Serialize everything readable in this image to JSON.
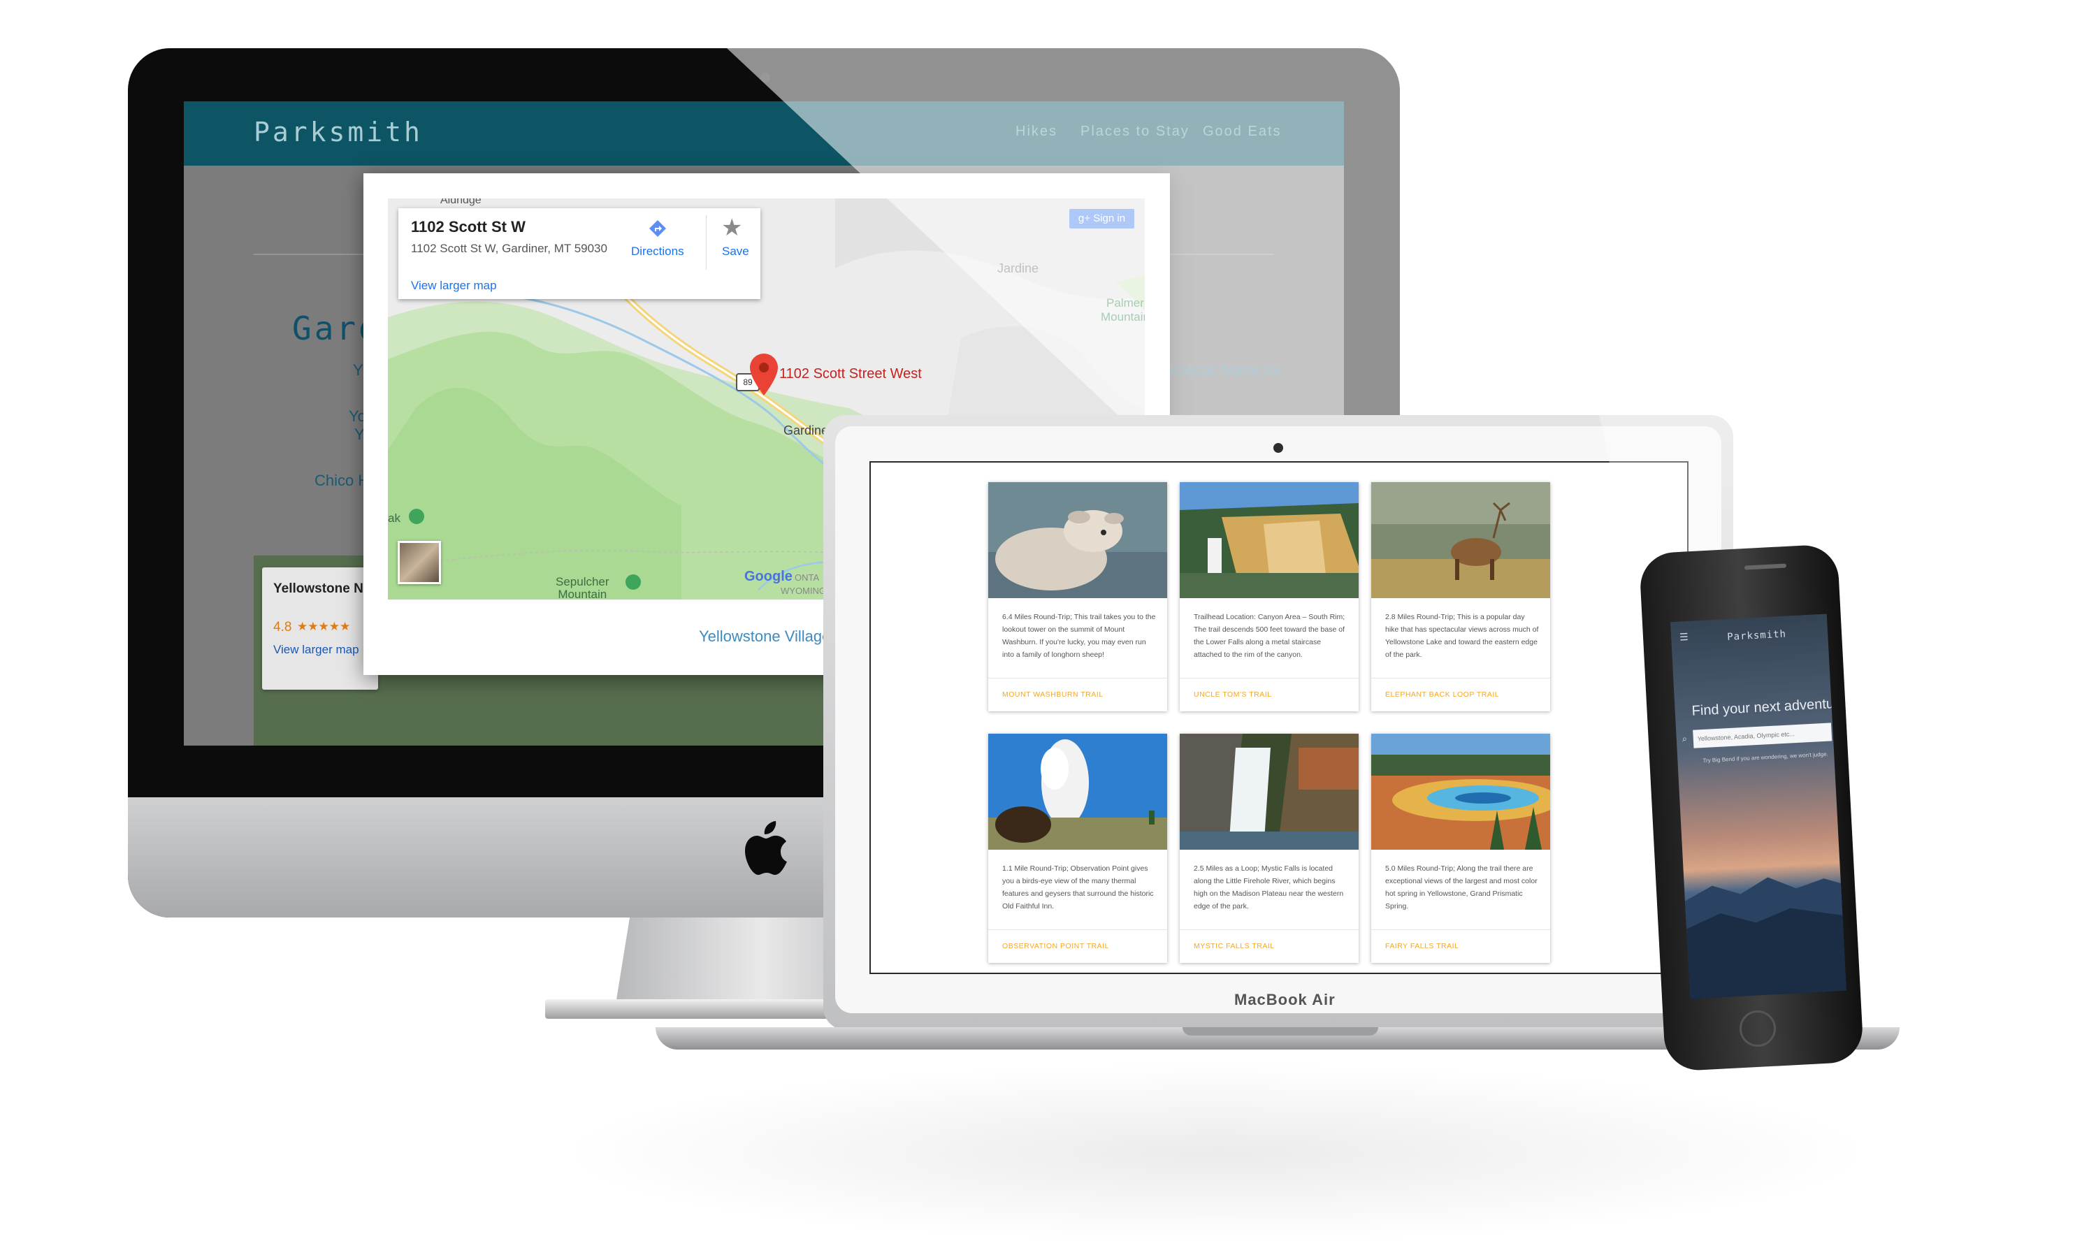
{
  "imac": {
    "site": {
      "logo": "Parksmith",
      "menu": [
        "Hikes",
        "Places to Stay",
        "Good Eats"
      ],
      "heading": "Gard",
      "text_lines": [
        {
          "text": "Y"
        },
        {
          "text": "Yo"
        },
        {
          "text": "Y"
        },
        {
          "text": "Chico H"
        }
      ],
      "right_text": "eclectic home for",
      "place_card": {
        "title": "Yellowstone N",
        "rating": "4.8",
        "stars": "★★★★★",
        "link": "View larger map"
      }
    },
    "map": {
      "info_title": "1102 Scott St W",
      "info_address": "1102 Scott St W, Gardiner, MT 59030",
      "directions_label": "Directions",
      "save_label": "Save",
      "view_larger": "View larger map",
      "sign_in": "Sign in",
      "pin_label": "1102 Scott Street West",
      "labels": {
        "top": "Aldridge",
        "jardine": "Jardine",
        "palmer": "Palmer\nMountain",
        "gardiner": "Gardiner",
        "route": "89",
        "sepulcher": "Sepulcher\nMountain",
        "peak": "ak",
        "google": "Google",
        "wyoming": "WYOMING",
        "montana": "ONTA"
      },
      "link_below": "Yellowstone Village In"
    }
  },
  "macbook": {
    "brand": "MacBook Air",
    "cards": [
      {
        "text": "6.4 Miles Round-Trip; This trail takes you to the lookout tower on the summit of Mount Washburn. If you're lucky, you may even run into a family of longhorn sheep!",
        "link": "MOUNT WASHBURN TRAIL",
        "image": "bighorn-lamb"
      },
      {
        "text": "Trailhead Location: Canyon Area – South Rim; The trail descends 500 feet toward the base of the Lower Falls along a metal staircase attached to the rim of the canyon.",
        "link": "UNCLE TOM'S TRAIL",
        "image": "canyon-falls"
      },
      {
        "text": "2.8 Miles Round-Trip; This is a popular day hike that has spectacular views across much of Yellowstone Lake and toward the eastern edge of the park.",
        "link": "ELEPHANT BACK LOOP TRAIL",
        "image": "elk"
      },
      {
        "text": "1.1 Mile Round-Trip; Observation Point gives you a birds-eye view of the many thermal features and geysers that surround the historic Old Faithful Inn.",
        "link": "OBSERVATION POINT TRAIL",
        "image": "geyser-bison"
      },
      {
        "text": "2.5 Miles as a Loop; Mystic Falls is located along the Little Firehole River, which begins high on the Madison Plateau near the western edge of the park.",
        "link": "MYSTIC FALLS TRAIL",
        "image": "waterfall"
      },
      {
        "text": "5.0 Miles Round-Trip; Along the trail there are exceptional views of the largest and most color hot spring in Yellowstone, Grand Prismatic Spring.",
        "link": "FAIRY FALLS TRAIL",
        "image": "prismatic-spring"
      }
    ]
  },
  "iphone": {
    "logo": "Parksmith",
    "headline": "Find your next adventure",
    "search_placeholder": "Yellowstone, Acadia, Olympic etc...",
    "subtext": "Try Big Bend if you are wondering, we won't judge."
  }
}
